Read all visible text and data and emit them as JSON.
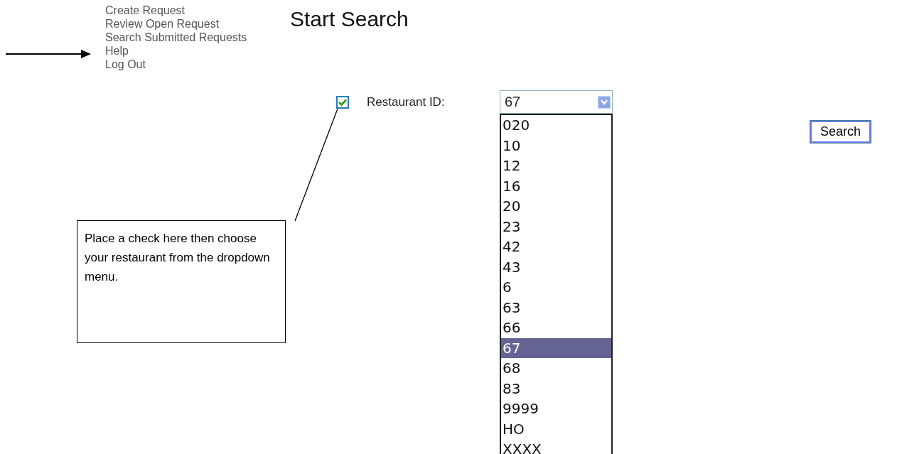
{
  "nav": {
    "items": [
      {
        "label": "Create Request"
      },
      {
        "label": "Review Open Request"
      },
      {
        "label": "Search Submitted Requests"
      },
      {
        "label": "Help"
      },
      {
        "label": "Log Out"
      }
    ]
  },
  "heading": "Start Search",
  "filter": {
    "checked": true,
    "label": "Restaurant ID:",
    "value": "67",
    "expanded": true,
    "options": [
      {
        "label": "020",
        "selected": false
      },
      {
        "label": "10",
        "selected": false
      },
      {
        "label": "12",
        "selected": false
      },
      {
        "label": "16",
        "selected": false
      },
      {
        "label": "20",
        "selected": false
      },
      {
        "label": "23",
        "selected": false
      },
      {
        "label": "42",
        "selected": false
      },
      {
        "label": "43",
        "selected": false
      },
      {
        "label": "6",
        "selected": false
      },
      {
        "label": "63",
        "selected": false
      },
      {
        "label": "66",
        "selected": false
      },
      {
        "label": "67",
        "selected": true
      },
      {
        "label": "68",
        "selected": false
      },
      {
        "label": "83",
        "selected": false
      },
      {
        "label": "9999",
        "selected": false
      },
      {
        "label": "HO",
        "selected": false
      },
      {
        "label": "XXXX",
        "selected": false
      }
    ]
  },
  "search_button": "Search",
  "callout": {
    "text": "Place a check here then choose your restaurant from the dropdown menu."
  }
}
